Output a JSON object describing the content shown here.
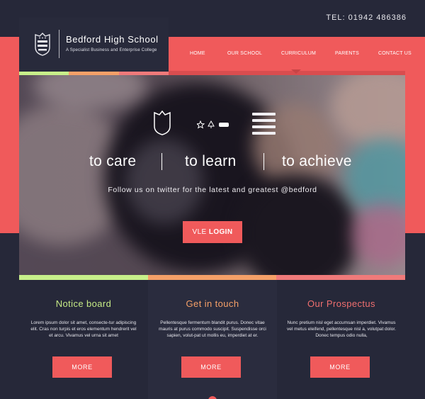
{
  "colors": {
    "background": "#262839",
    "accent": "#f05a5b",
    "strip_green": "#c8f08a",
    "strip_orange": "#f5a068",
    "strip_coral": "#f07a7a",
    "notice_title": "#c6ea86",
    "touch_title": "#f5a068",
    "prospectus_title": "#f06f6f"
  },
  "header": {
    "phone": "TEL: 01942 486386"
  },
  "logo": {
    "name": "Bedford High School",
    "tagline": "A Specialist Business and Enterprise College",
    "icon": "crest-icon"
  },
  "nav": {
    "items": [
      {
        "label": "HOME"
      },
      {
        "label": "OUR SCHOOL"
      },
      {
        "label": "CURRICULUM"
      },
      {
        "label": "PARENTS"
      },
      {
        "label": "CONTACT US"
      }
    ],
    "active_index": 2
  },
  "hero": {
    "slogan": [
      "to care",
      "to learn",
      "to achieve"
    ],
    "twitter_text": "Follow us on twitter for the latest and greatest @bedford",
    "vle_prefix": "VLE",
    "vle_bold": "LOGIN",
    "icons": [
      "crest-icon",
      "star-icon",
      "tree-icon",
      "car-icon",
      "menu-icon"
    ]
  },
  "columns": [
    {
      "title": "Notice board",
      "text": "Lorem ipsum dolor sit amet, consecte-tur adipiscing elit. Cras non turpis et eros elementum hendrerit vel et arcu. Vivamus vel urna sit amet",
      "button": "MORE"
    },
    {
      "title": "Get in touch",
      "text": "Pellentesque fermentum blandit purus. Donec vitae mauris at purus commodo suscipit. Suspendisse orci sapien, volut-pat ut mollis eu, imperdiet at er.",
      "button": "MORE"
    },
    {
      "title": "Our Prospectus",
      "text": "Nunc pretium nisl eget accumsan imperdiet. Vivamus vel metus eleifend, pellentesque nisl a, volutpat dolor. Donec tempus odio nulla,",
      "button": "MORE"
    }
  ]
}
